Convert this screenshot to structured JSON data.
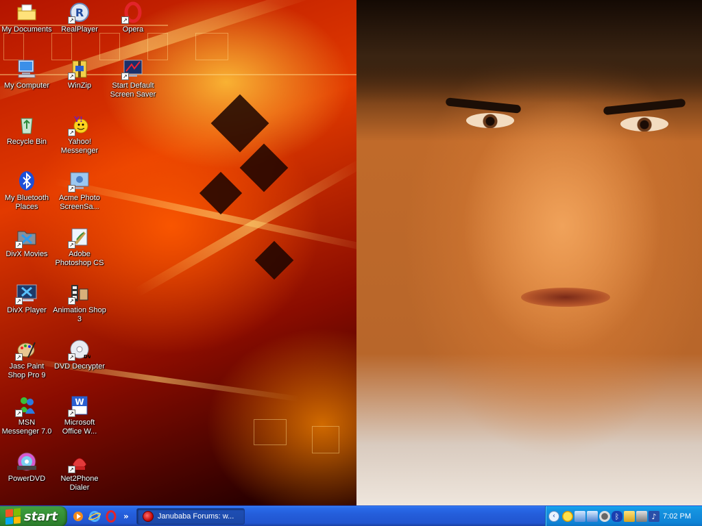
{
  "desktop": {
    "icons": [
      {
        "label": "My Documents",
        "icon": "folder-documents-icon",
        "shortcut": false
      },
      {
        "label": "RealPlayer",
        "icon": "realplayer-icon",
        "shortcut": true
      },
      {
        "label": "Opera",
        "icon": "opera-icon",
        "shortcut": true
      },
      {
        "label": "My Computer",
        "icon": "computer-icon",
        "shortcut": false
      },
      {
        "label": "WinZip",
        "icon": "winzip-icon",
        "shortcut": true
      },
      {
        "label": "Start Default\nScreen Saver",
        "icon": "screensaver-icon",
        "shortcut": true
      },
      {
        "label": "Recycle Bin",
        "icon": "recycle-bin-icon",
        "shortcut": false
      },
      {
        "label": "Yahoo!\nMessenger",
        "icon": "yahoo-messenger-icon",
        "shortcut": true
      },
      {
        "label": "My Bluetooth\nPlaces",
        "icon": "bluetooth-icon",
        "shortcut": false
      },
      {
        "label": "Acme Photo\nScreenSa...",
        "icon": "acme-photo-icon",
        "shortcut": true
      },
      {
        "label": "DivX Movies",
        "icon": "divx-movies-icon",
        "shortcut": true
      },
      {
        "label": "Adobe\nPhotoshop CS",
        "icon": "photoshop-icon",
        "shortcut": true
      },
      {
        "label": "DivX Player",
        "icon": "divx-player-icon",
        "shortcut": true
      },
      {
        "label": "Animation Shop\n3",
        "icon": "animation-shop-icon",
        "shortcut": true
      },
      {
        "label": "Jasc Paint\nShop Pro 9",
        "icon": "paint-shop-pro-icon",
        "shortcut": true
      },
      {
        "label": "DVD Decrypter",
        "icon": "dvd-decrypter-icon",
        "shortcut": true
      },
      {
        "label": "MSN\nMessenger 7.0",
        "icon": "msn-messenger-icon",
        "shortcut": true
      },
      {
        "label": "Microsoft\nOffice W...",
        "icon": "word-icon",
        "shortcut": true
      },
      {
        "label": "PowerDVD",
        "icon": "powerdvd-icon",
        "shortcut": false
      },
      {
        "label": "Net2Phone\nDialer",
        "icon": "net2phone-icon",
        "shortcut": true
      }
    ]
  },
  "taskbar": {
    "start_label": "start",
    "quick_launch": [
      {
        "icon": "media-player-icon"
      },
      {
        "icon": "internet-explorer-icon"
      },
      {
        "icon": "opera-icon"
      }
    ],
    "quick_launch_more": "»",
    "task_button_label": "Janubaba Forums: w...",
    "tray_expand": "‹",
    "tray_icons": [
      "messenger-smiley-icon",
      "network-icon",
      "network-icon-2",
      "antivirus-icon",
      "bluetooth-tray-icon",
      "monitor-icon",
      "display-icon",
      "speaker-icon"
    ],
    "clock": "7:02 PM"
  },
  "colors": {
    "taskbar_blue": "#245edb",
    "start_green": "#3c9b3c",
    "tray_blue": "#0f83d6"
  }
}
